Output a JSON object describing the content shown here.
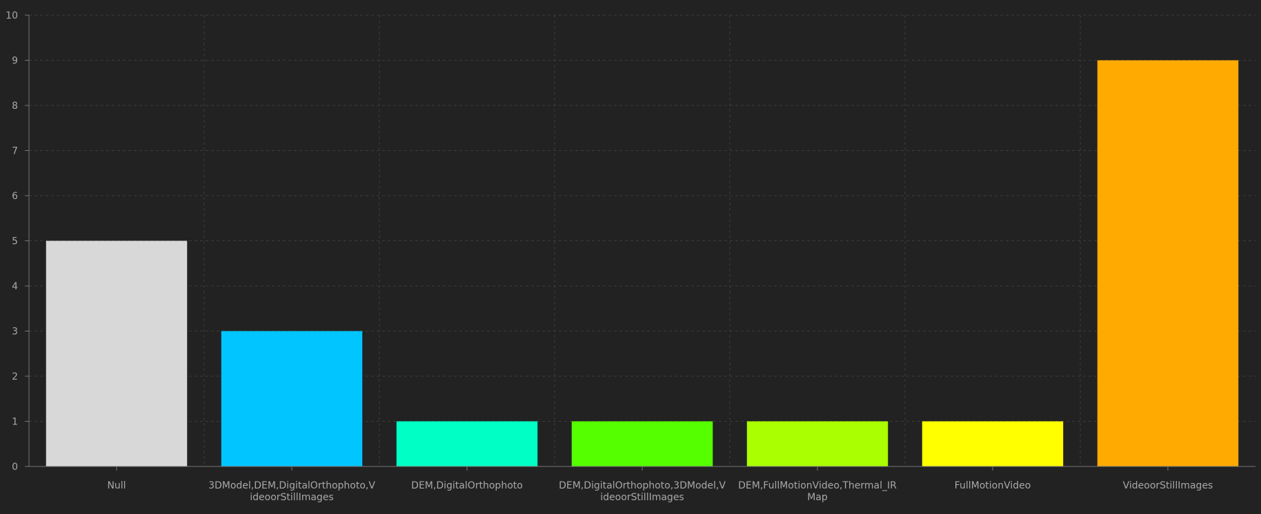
{
  "chart_data": {
    "type": "bar",
    "title": "",
    "xlabel": "",
    "ylabel": "",
    "ylim": [
      0,
      10
    ],
    "yticks": [
      0,
      1,
      2,
      3,
      4,
      5,
      6,
      7,
      8,
      9,
      10
    ],
    "grid": true,
    "categories": [
      "Null",
      "3DModel,DEM,DigitalOrthophoto,VideoorStillImages",
      "DEM,DigitalOrthophoto",
      "DEM,DigitalOrthophoto,3DModel,VideoorStillImages",
      "DEM,FullMotionVideo,Thermal_IRMap",
      "FullMotionVideo",
      "VideoorStillImages"
    ],
    "category_label_lines": [
      [
        "Null"
      ],
      [
        "3DModel,DEM,DigitalOrthophoto,V",
        "ideoorStillImages"
      ],
      [
        "DEM,DigitalOrthophoto"
      ],
      [
        "DEM,DigitalOrthophoto,3DModel,V",
        "ideoorStillImages"
      ],
      [
        "DEM,FullMotionVideo,Thermal_IR",
        "Map"
      ],
      [
        "FullMotionVideo"
      ],
      [
        "VideoorStillImages"
      ]
    ],
    "values": [
      5,
      3,
      1,
      1,
      1,
      1,
      9
    ],
    "colors": [
      "#d8d8d8",
      "#00c5ff",
      "#00ffc5",
      "#55ff00",
      "#aaff00",
      "#ffff00",
      "#ffaa00"
    ]
  },
  "style": {
    "background": "#222222",
    "grid_color": "#3c3c3c",
    "axis_color": "#777777",
    "text_color": "#a8a8a8"
  }
}
